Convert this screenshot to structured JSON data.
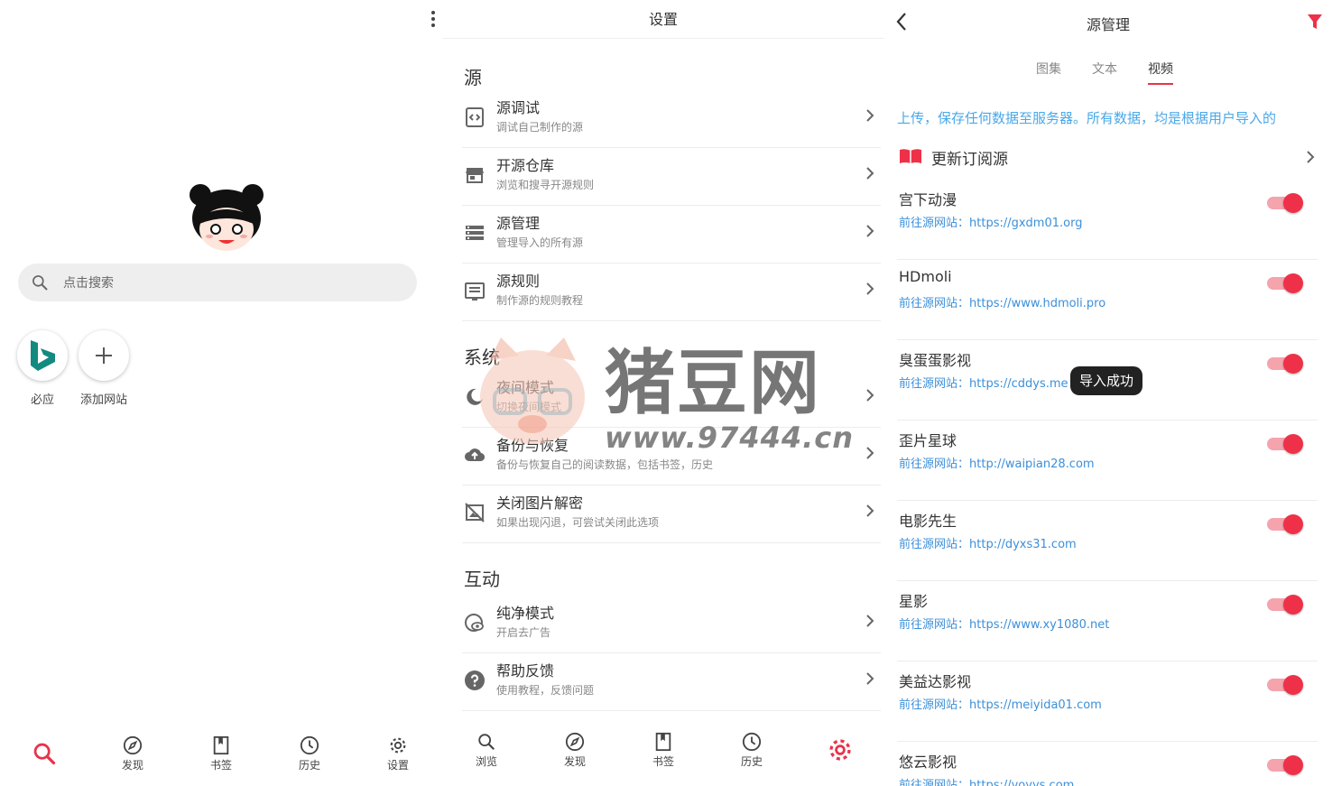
{
  "home": {
    "search_placeholder": "点击搜索",
    "shortcuts": [
      {
        "label": "必应",
        "icon": "bing-logo-icon"
      },
      {
        "label": "添加网站",
        "icon": "plus-icon"
      }
    ],
    "nav": [
      {
        "label": "",
        "icon": "search-icon",
        "active": true
      },
      {
        "label": "发现",
        "icon": "compass-icon"
      },
      {
        "label": "书签",
        "icon": "bookmark-icon"
      },
      {
        "label": "历史",
        "icon": "clock-icon"
      },
      {
        "label": "设置",
        "icon": "gear-icon"
      }
    ]
  },
  "settings": {
    "title": "设置",
    "sections": {
      "source": "源",
      "system": "系统",
      "interact": "互动"
    },
    "items": [
      {
        "title": "源调试",
        "sub": "调试自己制作的源",
        "icon": "code-icon"
      },
      {
        "title": "开源仓库",
        "sub": "浏览和搜寻开源规则",
        "icon": "store-icon"
      },
      {
        "title": "源管理",
        "sub": "管理导入的所有源",
        "icon": "list-icon"
      },
      {
        "title": "源规则",
        "sub": "制作源的规则教程",
        "icon": "doc-icon"
      },
      {
        "title": "夜间模式",
        "sub": "切换夜间模式",
        "icon": "moon-icon"
      },
      {
        "title": "备份与恢复",
        "sub": "备份与恢复自己的阅读数据，包括书签，历史",
        "icon": "cloud-upload-icon"
      },
      {
        "title": "关闭图片解密",
        "sub": "如果出现闪退，可尝试关闭此选项",
        "icon": "image-off-icon"
      },
      {
        "title": "纯净模式",
        "sub": "开启去广告",
        "icon": "eye-shield-icon"
      },
      {
        "title": "帮助反馈",
        "sub": "使用教程，反馈问题",
        "icon": "help-icon"
      }
    ],
    "watermark": {
      "text": "猪豆网",
      "url": "www.97444.cn"
    },
    "nav": [
      {
        "label": "浏览",
        "icon": "search-icon"
      },
      {
        "label": "发现",
        "icon": "compass-icon"
      },
      {
        "label": "书签",
        "icon": "bookmark-icon"
      },
      {
        "label": "历史",
        "icon": "clock-icon"
      },
      {
        "label": "",
        "icon": "gear-icon",
        "active": true
      }
    ]
  },
  "sources": {
    "title": "源管理",
    "tabs": [
      "图集",
      "文本",
      "视频"
    ],
    "active_tab": "视频",
    "marquee": "上传，保存任何数据至服务器。所有数据，均是根据用户导入的",
    "update_label": "更新订阅源",
    "toast": "导入成功",
    "items": [
      {
        "name": "宫下动漫",
        "prefix": "前往源网站：",
        "url": "https://gxdm01.org",
        "enabled": true
      },
      {
        "name": "HDmoli",
        "prefix": "前往源网站：",
        "url": "https://www.hdmoli.pro",
        "enabled": true
      },
      {
        "name": "臭蛋蛋影视",
        "prefix": "前往源网站：",
        "url": "https://cddys.me",
        "enabled": true
      },
      {
        "name": "歪片星球",
        "prefix": "前往源网站：",
        "url": "http://waipian28.com",
        "enabled": true
      },
      {
        "name": "电影先生",
        "prefix": "前往源网站：",
        "url": "http://dyxs31.com",
        "enabled": true
      },
      {
        "name": "星影",
        "prefix": "前往源网站：",
        "url": "https://www.xy1080.net",
        "enabled": true
      },
      {
        "name": "美益达影视",
        "prefix": "前往源网站：",
        "url": "https://meiyida01.com",
        "enabled": true
      },
      {
        "name": "悠云影视",
        "prefix": "前往源网站：",
        "url": "https://yoyys.com",
        "enabled": true
      }
    ],
    "colors": {
      "accent": "#ee3148",
      "link": "#3c8fd9",
      "marquee": "#4aa8e8"
    }
  }
}
